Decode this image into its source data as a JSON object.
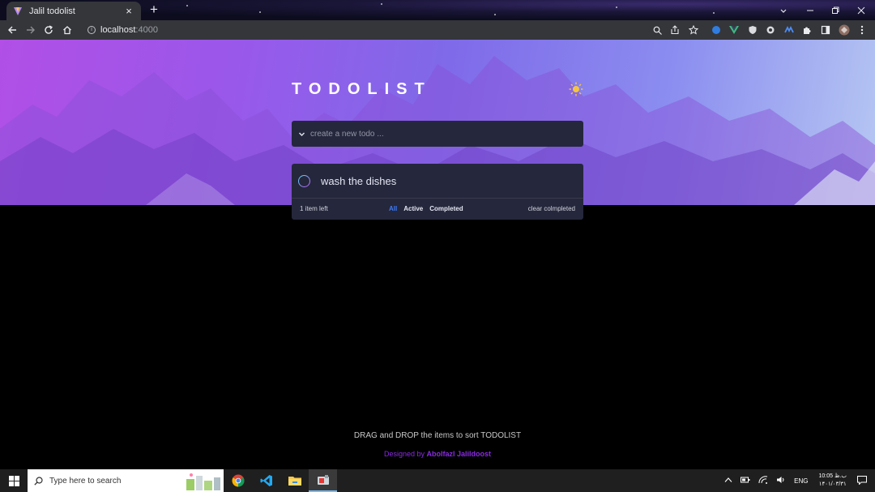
{
  "browser": {
    "tab_title": "Jalil todolist",
    "new_tab": "+",
    "url_host": "localhost",
    "url_port": ":4000"
  },
  "app": {
    "title": "TODOLIST",
    "input_placeholder": "create a new todo ...",
    "todos": [
      {
        "text": "wash the dishes",
        "completed": false
      }
    ],
    "footer": {
      "items_left": "1 item left",
      "filters": [
        "All",
        "Active",
        "Completed"
      ],
      "active_filter": "All",
      "clear": "clear colmpleted"
    },
    "hint": "DRAG and DROP the items to sort TODOLIST",
    "credit_prefix": "Designed by",
    "credit_name": "Abolfazl Jalildoost"
  },
  "taskbar": {
    "search_placeholder": "Type here to search",
    "lang": "ENG",
    "time": "10:05 ب.ظ",
    "date": "۱۴۰۱/۰۳/۳۱"
  },
  "colors": {
    "card": "#25273c",
    "accent_blue": "#3a7cfd",
    "credit_purple": "#8a2be2"
  }
}
